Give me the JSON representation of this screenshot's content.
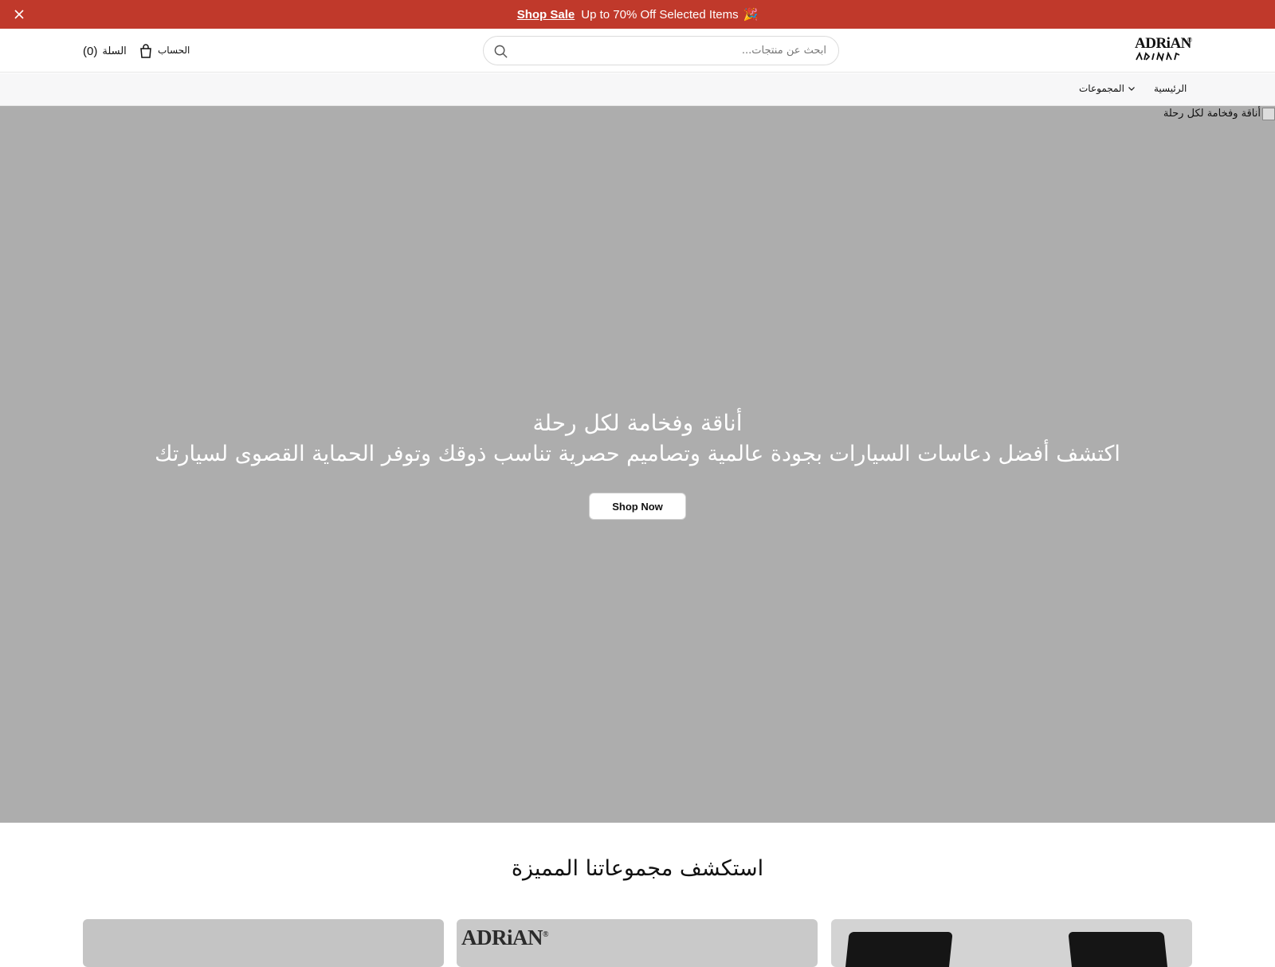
{
  "announcement": {
    "link_label": "Shop Sale",
    "text": "Up to 70% Off Selected Items",
    "emoji": "🎉",
    "close_icon": "close-icon",
    "background": "#c0392b"
  },
  "header": {
    "logo_text": "ADRiAN",
    "logo_registered": "®",
    "search_placeholder": "ابحث عن منتجات...",
    "account_label": "الحساب",
    "cart_label": "السلة",
    "cart_count": "(0)"
  },
  "nav": {
    "items": [
      {
        "label": "الرئيسية"
      },
      {
        "label": "المجموعات",
        "has_dropdown": true
      }
    ]
  },
  "hero": {
    "image_alt": "أناقة وفخامة لكل رحلة",
    "title": "أناقة وفخامة لكل رحلة",
    "subtitle": "اكتشف أفضل دعاسات السيارات بجودة عالمية وتصاميم حصرية تناسب ذوقك وتوفر الحماية القصوى لسيارتك",
    "button_label": "Shop Now",
    "background": "#adadad"
  },
  "collections": {
    "title": "استكشف مجموعاتنا المميزة",
    "cards": [
      {
        "type": "blank"
      },
      {
        "brand": "ADRiAN",
        "registered": "®"
      },
      {
        "type": "car-mats"
      }
    ]
  }
}
